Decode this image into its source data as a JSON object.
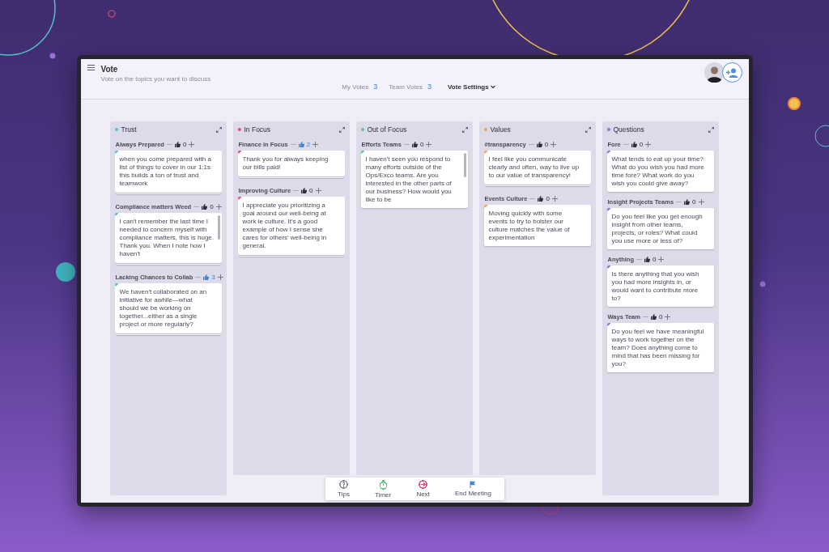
{
  "header": {
    "title": "Vote",
    "subtitle": "Vote on the topics you want to discuss",
    "my_votes": {
      "label": "My Votes",
      "value": "3"
    },
    "team_votes": {
      "label": "Team Votes",
      "value": "3"
    },
    "settings": "Vote Settings"
  },
  "columns": [
    {
      "name": "Trust",
      "color": "#5bbccc",
      "tall": true,
      "groups": [
        {
          "title": "Always Prepared",
          "votes": "0",
          "voted": false,
          "stacked": true,
          "scrolling": false,
          "text": "when you come prepared with a list of things to cover in our 1:1s this builds a ton of trust and teamwork"
        },
        {
          "title": "Compliance matters Weed",
          "votes": "0",
          "voted": false,
          "stacked": true,
          "scrolling": true,
          "text": "I can't remember the last time I needed to concern myself with compliance matters, this is huge. Thank you. When I note how I haven't"
        },
        {
          "title": "Lacking Chances to Collab",
          "votes": "3",
          "voted": true,
          "stacked": true,
          "scrolling": false,
          "text": "We haven't collaborated on an initiative for awhile—what should we be working on together...either as a single project or more regularly?"
        }
      ]
    },
    {
      "name": "In Focus",
      "color": "#e0507a",
      "tall": false,
      "groups": [
        {
          "title": "Finance in Focus",
          "votes": "2",
          "voted": true,
          "stacked": true,
          "scrolling": false,
          "text": "Thank you for always keeping our bills paid!"
        },
        {
          "title": "Improving Culture",
          "votes": "0",
          "voted": false,
          "stacked": true,
          "scrolling": false,
          "text": "I appreciate you prioritizing a goal around our well-being at work ie culture. It's a good example of how I sense she cares for others' well-being in general."
        }
      ]
    },
    {
      "name": "Out of Focus",
      "color": "#6cbf84",
      "tall": false,
      "groups": [
        {
          "title": "Efforts Teams",
          "votes": "0",
          "voted": false,
          "stacked": false,
          "scrolling": true,
          "text": "I haven't seen you respond to many efforts outside of the Ops/Exco teams. Are you interested in the other parts of our business? How would you like to be"
        }
      ]
    },
    {
      "name": "Values",
      "color": "#f0a05a",
      "tall": false,
      "groups": [
        {
          "title": "#transparency",
          "votes": "0",
          "voted": false,
          "stacked": true,
          "scrolling": false,
          "text": "I feel like you communicate clearly and often, way to live up to our value of transparency!"
        },
        {
          "title": "Events Culture",
          "votes": "0",
          "voted": false,
          "stacked": false,
          "scrolling": false,
          "text": "Moving quickly with some events to try to bolster our culture matches the value of experimentation"
        }
      ]
    },
    {
      "name": "Questions",
      "color": "#9a6fd8",
      "tall": true,
      "groups": [
        {
          "title": "Fore",
          "votes": "0",
          "voted": false,
          "stacked": false,
          "scrolling": false,
          "text": "What tends to eat up your time? What do you wish you had more time fore? What work do you wish you could give away?"
        },
        {
          "title": "Insight Projects Teams",
          "votes": "0",
          "voted": false,
          "stacked": false,
          "scrolling": false,
          "text": "Do you feel like you get enough insight from other teams, projects, or roles? What could you use more or less of?"
        },
        {
          "title": "Anything",
          "votes": "0",
          "voted": false,
          "stacked": false,
          "scrolling": false,
          "text": "Is there anything that you wish you had more insights in, or would want to contribute more to?"
        },
        {
          "title": "Ways Team",
          "votes": "0",
          "voted": false,
          "stacked": false,
          "scrolling": false,
          "text": "Do you feel we have meaningful ways to work together on the team? Does anything come to mind that has been missing for you?"
        }
      ]
    }
  ],
  "toolbar": [
    {
      "kind": "tips",
      "label": "Tips",
      "color": "#8a8a96"
    },
    {
      "kind": "timer",
      "label": "Timer",
      "color": "#6cbf84"
    },
    {
      "kind": "next",
      "label": "Next",
      "color": "#e0507a"
    },
    {
      "kind": "end",
      "label": "End Meeting",
      "color": "#3b82d8"
    }
  ]
}
